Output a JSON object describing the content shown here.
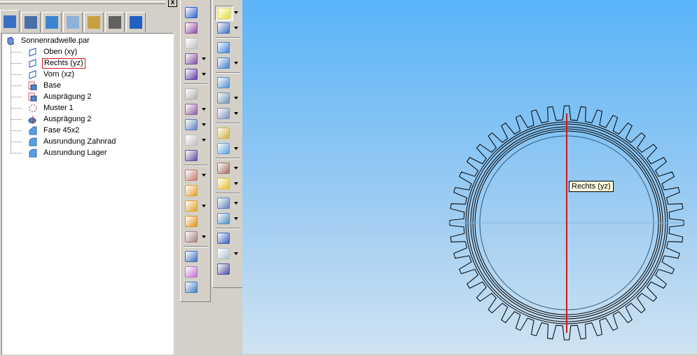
{
  "panel": {
    "close_label": "x",
    "tabs": [
      {
        "name": "feature-tree",
        "color": "#3a6fc8"
      },
      {
        "name": "layers",
        "color": "#4a6ea8"
      },
      {
        "name": "assembly",
        "color": "#3b84d0"
      },
      {
        "name": "layer-stack",
        "color": "#8fb0d8"
      },
      {
        "name": "color-manager",
        "color": "#c8a040"
      },
      {
        "name": "camera-view",
        "color": "#606060"
      },
      {
        "name": "settings",
        "color": "#2060c0"
      }
    ]
  },
  "tree": {
    "root": "Sonnenradwelle.par",
    "items": [
      {
        "label": "Oben (xy)",
        "icon": "reference-plane",
        "selected": false
      },
      {
        "label": "Rechts (yz)",
        "icon": "reference-plane",
        "selected": true
      },
      {
        "label": "Vorn (xz)",
        "icon": "reference-plane",
        "selected": false
      },
      {
        "label": "Base",
        "icon": "protrusion",
        "selected": false
      },
      {
        "label": "Ausprägung 2",
        "icon": "protrusion",
        "selected": false
      },
      {
        "label": "Muster 1",
        "icon": "pattern",
        "selected": false
      },
      {
        "label": "Ausprägung 2",
        "icon": "revolved-protrusion",
        "selected": false
      },
      {
        "label": "Fase 45x2",
        "icon": "chamfer",
        "selected": false
      },
      {
        "label": "Ausrundung Zahnrad",
        "icon": "round",
        "selected": false
      },
      {
        "label": "Ausrundung Lager",
        "icon": "round",
        "selected": false
      }
    ]
  },
  "toolbar1": [
    {
      "name": "sweep",
      "color": "#3060d0",
      "drop": false
    },
    {
      "name": "helix",
      "color": "#9050a0",
      "drop": false
    },
    {
      "name": "thin-wall",
      "color": "#c0c0c0",
      "drop": false
    },
    {
      "name": "rib",
      "color": "#8050a0",
      "drop": true
    },
    {
      "name": "web-network",
      "color": "#6040a0",
      "drop": true
    },
    "sep",
    {
      "name": "hole-point",
      "color": "#b0b0b0",
      "drop": false
    },
    {
      "name": "cut-plane",
      "color": "#9060a0",
      "drop": true
    },
    {
      "name": "lip",
      "color": "#6080c0",
      "drop": true
    },
    {
      "name": "vent",
      "color": "#c0c0c0",
      "drop": true
    },
    {
      "name": "thicken",
      "color": "#6050a0",
      "drop": false
    },
    "sep",
    {
      "name": "curve",
      "color": "#c08070",
      "drop": true
    },
    {
      "name": "surface-sweep",
      "color": "#e0a030",
      "drop": false
    },
    {
      "name": "blue-surface",
      "color": "#e0a030",
      "drop": true
    },
    {
      "name": "bounded-surface",
      "color": "#e09020",
      "drop": false
    },
    {
      "name": "split-curve",
      "color": "#a08080",
      "drop": true
    },
    "sep",
    {
      "name": "mirror-copy",
      "color": "#4070c0",
      "drop": false
    },
    {
      "name": "part-copy",
      "color": "#c070d0",
      "drop": false
    },
    {
      "name": "link",
      "color": "#4080c0",
      "drop": false
    }
  ],
  "toolbar2": [
    {
      "name": "select-tool",
      "color": "#e0e040",
      "drop": true
    },
    {
      "name": "sketch",
      "color": "#4070c0",
      "drop": true
    },
    "sep",
    {
      "name": "protrusion",
      "color": "#4080d0",
      "drop": false
    },
    {
      "name": "revolved-protrusion",
      "color": "#4080d0",
      "drop": true
    },
    "sep",
    {
      "name": "cutout",
      "color": "#5090d0",
      "drop": false
    },
    {
      "name": "hole",
      "color": "#7090b0",
      "drop": true
    },
    {
      "name": "slot",
      "color": "#8090c0",
      "drop": true
    },
    "sep",
    {
      "name": "draft",
      "color": "#d0b040",
      "drop": false
    },
    {
      "name": "round",
      "color": "#60a0e0",
      "drop": true
    },
    "sep",
    {
      "name": "pattern",
      "color": "#a07060",
      "drop": true
    },
    {
      "name": "mirror",
      "color": "#e0c030",
      "drop": true
    },
    "sep",
    {
      "name": "thin-region",
      "color": "#6080c0",
      "drop": true
    },
    {
      "name": "flange",
      "color": "#5090c0",
      "drop": true
    },
    "sep",
    {
      "name": "coordinate-system",
      "color": "#4060c0",
      "drop": false
    },
    {
      "name": "plane",
      "color": "#b0c0d0",
      "drop": true
    },
    {
      "name": "parallel-plane",
      "color": "#5050a0",
      "drop": false
    }
  ],
  "viewport": {
    "tooltip": "Rechts (yz)",
    "gear_teeth": 44,
    "plane_color": "#d01818",
    "edge_color": "#000000"
  }
}
